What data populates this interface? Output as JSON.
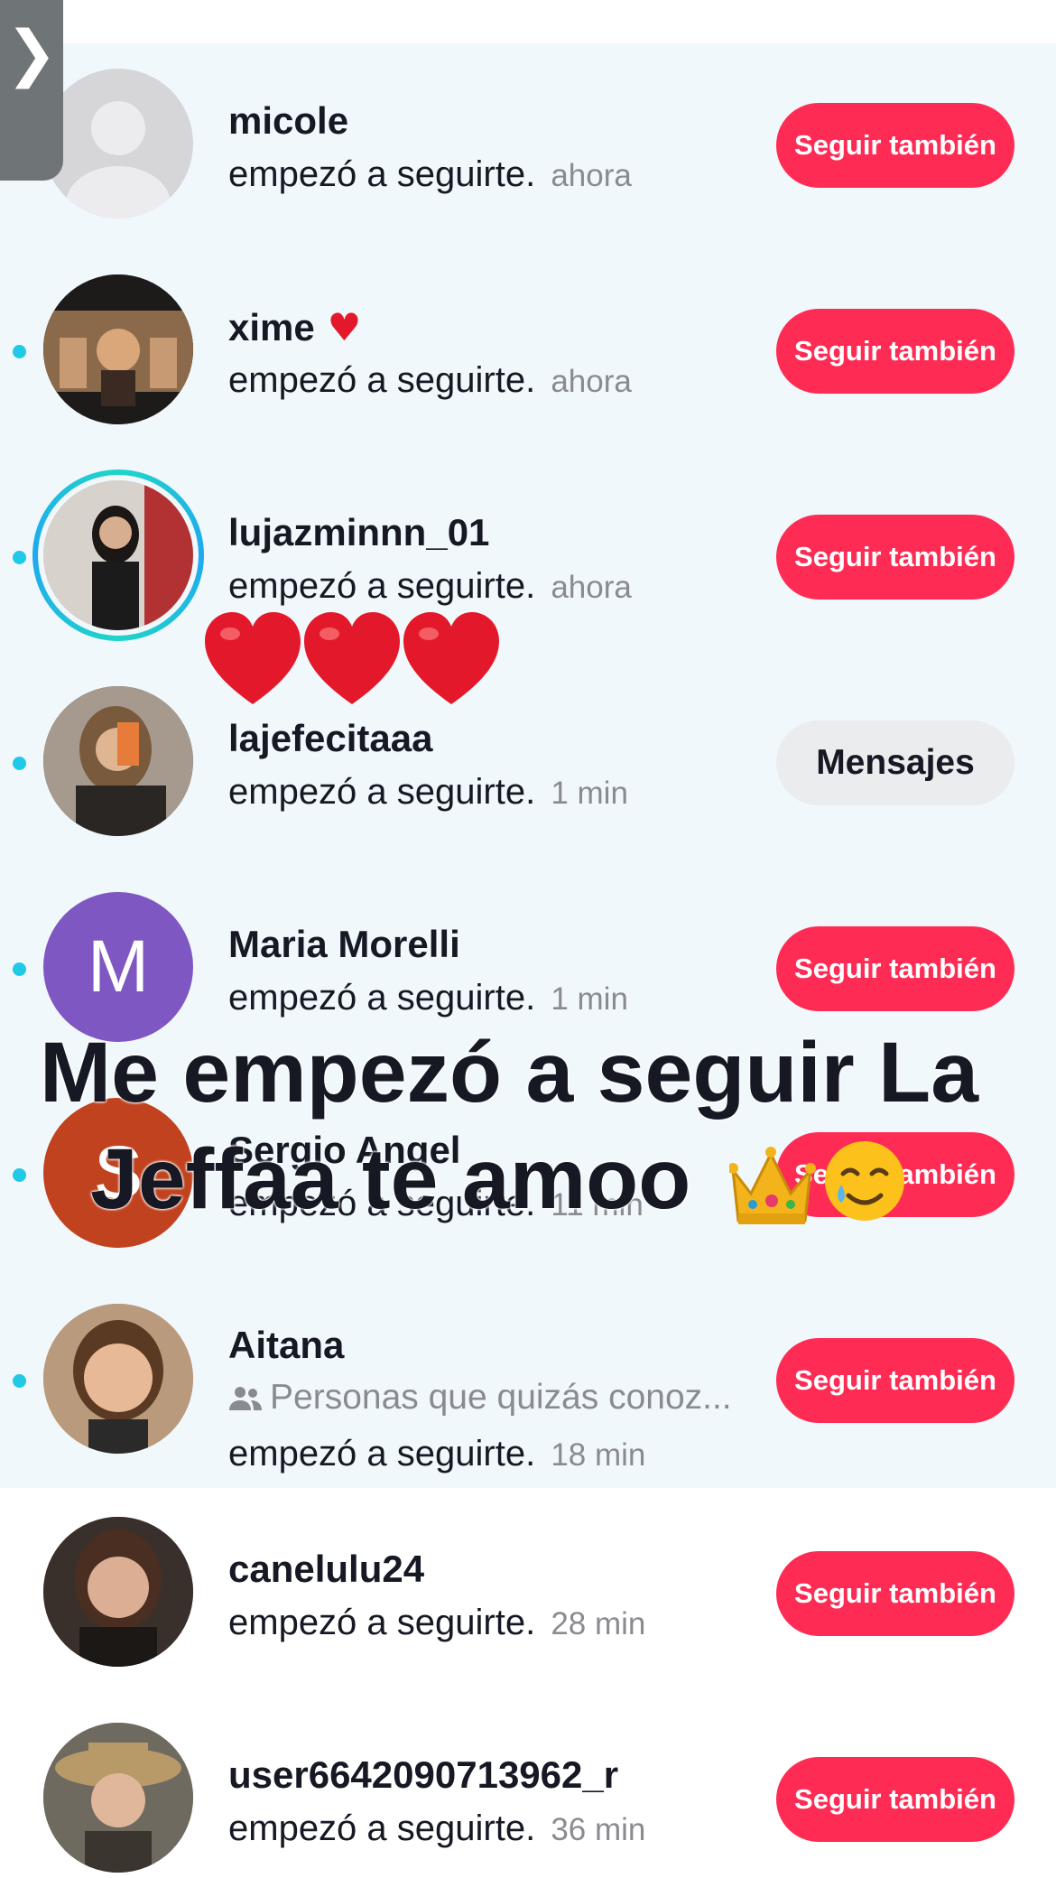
{
  "nav": {
    "back_glyph": "❯"
  },
  "action_text": "empezó a seguirte.",
  "follow_back_label": "Seguir también",
  "message_label": "Mensajes",
  "rows": [
    {
      "name": "micole",
      "time": "ahora",
      "unread": false,
      "button": "Seguir también",
      "avatar": "default-silhouette"
    },
    {
      "name": "xime",
      "name_suffix": "♥",
      "time": "ahora",
      "unread": true,
      "button": "Seguir también",
      "avatar": "photo"
    },
    {
      "name": "lujazminnn_01",
      "time": "ahora",
      "unread": true,
      "button": "Seguir también",
      "avatar": "photo-story-ring"
    },
    {
      "name": "lajefecitaaa",
      "time": "1 min",
      "unread": true,
      "button": "Mensajes",
      "avatar": "photo"
    },
    {
      "name": "Maria Morelli",
      "time": "1 min",
      "unread": true,
      "button": "Seguir también",
      "avatar": "letter",
      "avatar_letter": "M"
    },
    {
      "name": "Sergio Angel",
      "time": "11 min",
      "unread": true,
      "button": "Seguir también",
      "avatar": "letter",
      "avatar_letter": "S"
    },
    {
      "name": "Aitana",
      "subline": "Personas que quizás conoz...",
      "time": "18 min",
      "unread": true,
      "button": "Seguir también",
      "avatar": "photo"
    },
    {
      "name": "canelulu24",
      "time": "28 min",
      "unread": false,
      "button": "Seguir también",
      "avatar": "photo"
    },
    {
      "name": "user6642090713962_r",
      "time": "36 min",
      "unread": false,
      "button": "Seguir también",
      "avatar": "photo"
    }
  ],
  "overlay": {
    "line1": "Me empezó a seguir La",
    "line2": "Jeffaa te amoo",
    "emojis": [
      "crown-emoji",
      "smiling-face-with-tear-emoji"
    ]
  },
  "stickers": [
    "red-heart-emoji",
    "red-heart-emoji",
    "red-heart-emoji"
  ],
  "colors": {
    "accent": "#fe2c55",
    "unread_dot": "#20c9e6",
    "unread_bg": "#f1f8fb",
    "secondary_text": "#8a8b91",
    "letter_avatar_m": "#7e57c2",
    "letter_avatar_s": "#c1421e"
  }
}
